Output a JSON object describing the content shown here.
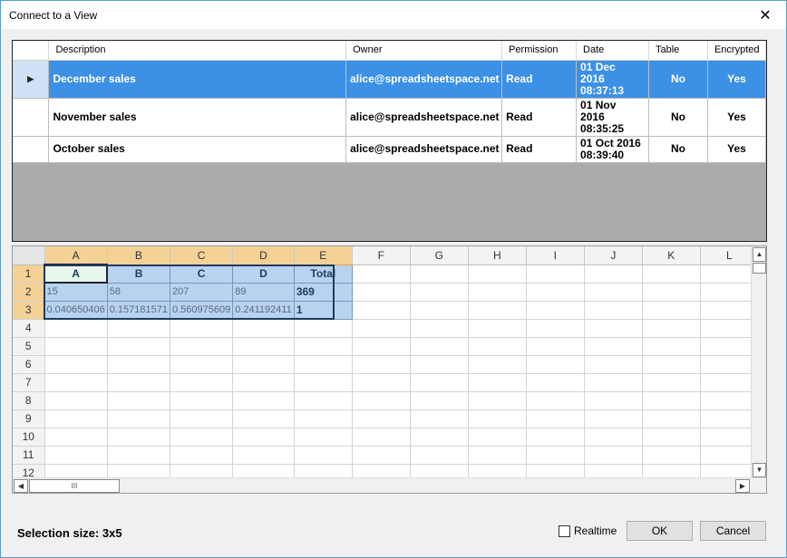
{
  "window": {
    "title": "Connect to a View",
    "close_glyph": "✕"
  },
  "views_table": {
    "columns": [
      "Description",
      "Owner",
      "Permission",
      "Date",
      "Table",
      "Encrypted"
    ],
    "rows": [
      {
        "description": "December sales",
        "owner": "alice@spreadsheetspace.net",
        "permission": "Read",
        "date_line1": "01 Dec",
        "date_line2": "2016",
        "date_line3": "08:37:13",
        "table": "No",
        "encrypted": "Yes"
      },
      {
        "description": "November sales",
        "owner": "alice@spreadsheetspace.net",
        "permission": "Read",
        "date_line1": "01 Nov",
        "date_line2": "2016",
        "date_line3": "08:35:25",
        "table": "No",
        "encrypted": "Yes"
      },
      {
        "description": "October sales",
        "owner": "alice@spreadsheetspace.net",
        "permission": "Read",
        "date_line1": "01 Oct 2016",
        "date_line2": "08:39:40",
        "table": "No",
        "encrypted": "Yes"
      }
    ]
  },
  "sheet": {
    "col_headers": [
      "A",
      "B",
      "C",
      "D",
      "E",
      "F",
      "G",
      "H",
      "I",
      "J",
      "K",
      "L"
    ],
    "row_headers": [
      "1",
      "2",
      "3",
      "4",
      "5",
      "6",
      "7",
      "8",
      "9",
      "10",
      "11",
      "12"
    ],
    "row1": [
      "A",
      "B",
      "C",
      "D",
      "Total"
    ],
    "row2": [
      "15",
      "58",
      "207",
      "89",
      "369"
    ],
    "row3": [
      "0.040650406",
      "0.157181571",
      "0.560975609",
      "0.241192411",
      "1"
    ]
  },
  "footer": {
    "selection_label": "Selection size: 3x5",
    "realtime_label": "Realtime",
    "ok_label": "OK",
    "cancel_label": "Cancel"
  }
}
